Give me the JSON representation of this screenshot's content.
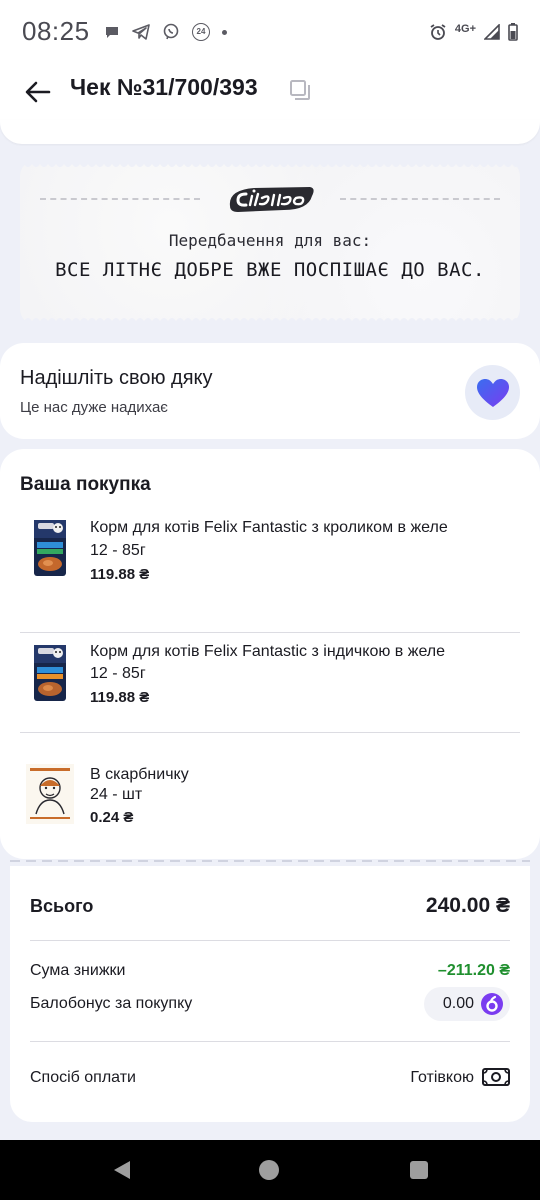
{
  "status_bar": {
    "time": "08:25",
    "badge_text": "24",
    "network": "4G+"
  },
  "header": {
    "title": "Чек №31/700/393"
  },
  "prediction": {
    "intro": "Передбачення для вас:",
    "text": "ВСЕ ЛІТНЄ ДОБРЕ ВЖЕ ПОСПІШАЄ ДО ВАС."
  },
  "thanks": {
    "title": "Надішліть свою дяку",
    "subtitle": "Це нас дуже надихає"
  },
  "purchase": {
    "title": "Ваша покупка",
    "items": [
      {
        "name": "Корм для котів Felix Fantastic з кроликом в желе",
        "qty": "12 - 85г",
        "price": "119.88 ₴"
      },
      {
        "name": "Корм для котів Felix Fantastic з індичкою в желе",
        "qty": "12 - 85г",
        "price": "119.88 ₴"
      },
      {
        "name": "В скарбничку",
        "qty": "24 - шт",
        "price": "0.24 ₴"
      }
    ]
  },
  "summary": {
    "total_label": "Всього",
    "total_value": "240.00 ₴",
    "discount_label": "Сума знижки",
    "discount_value": "–211.20 ₴",
    "bonus_label": "Балобонус за покупку",
    "bonus_value": "0.00",
    "payment_label": "Спосіб оплати",
    "payment_value": "Готівкою"
  },
  "colors": {
    "discount": "#1f8f2e",
    "accent_purple": "#7a3cf0",
    "background": "#eef0f8"
  },
  "icons": {
    "back": "arrow-left-icon",
    "copy": "copy-icon",
    "heart": "heart-icon",
    "bonus": "bonus-coin-icon",
    "payment": "cash-icon"
  }
}
